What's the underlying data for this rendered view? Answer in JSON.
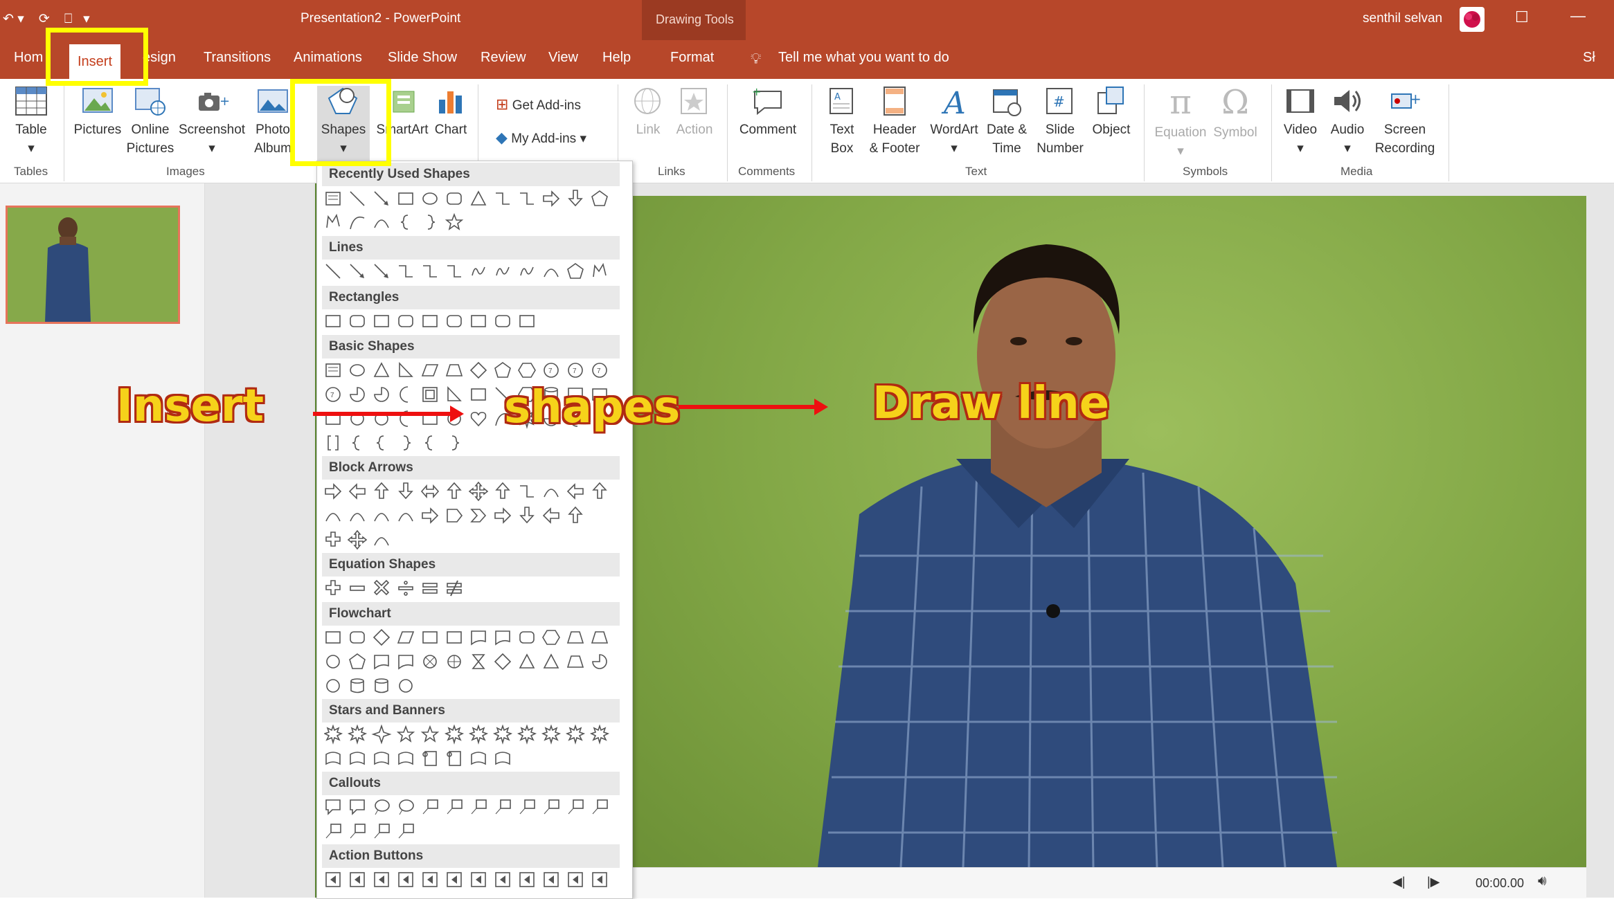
{
  "titlebar": {
    "doc_title": "Presentation2  -  PowerPoint",
    "context_tab_group": "Drawing Tools",
    "user_name": "senthil selvan"
  },
  "tabs": [
    {
      "label": "Hom"
    },
    {
      "label": "Insert"
    },
    {
      "label": "esign"
    },
    {
      "label": "Transitions"
    },
    {
      "label": "Animations"
    },
    {
      "label": "Slide Show"
    },
    {
      "label": "Review"
    },
    {
      "label": "View"
    },
    {
      "label": "Help"
    },
    {
      "label": "Format"
    }
  ],
  "tell_me": "Tell me what you want to do",
  "share_partial": "Sł",
  "ribbon": {
    "table": "Table",
    "pictures": "Pictures",
    "online_pictures_1": "Online",
    "online_pictures_2": "Pictures",
    "screenshot": "Screenshot",
    "photo_album_1": "Photo",
    "photo_album_2": "Album",
    "shapes": "Shapes",
    "smartart": "SmartArt",
    "chart": "Chart",
    "get_addins": "Get Add-ins",
    "my_addins": "My Add-ins",
    "link": "Link",
    "action": "Action",
    "comment": "Comment",
    "text_box_1": "Text",
    "text_box_2": "Box",
    "header_footer_1": "Header",
    "header_footer_2": "& Footer",
    "wordart": "WordArt",
    "date_time_1": "Date &",
    "date_time_2": "Time",
    "slide_number_1": "Slide",
    "slide_number_2": "Number",
    "object": "Object",
    "equation": "Equation",
    "symbol": "Symbol",
    "video": "Video",
    "audio": "Audio",
    "screen_recording_1": "Screen",
    "screen_recording_2": "Recording"
  },
  "groups": {
    "tables": "Tables",
    "images": "Images",
    "links": "Links",
    "comments": "Comments",
    "text": "Text",
    "symbols": "Symbols",
    "media": "Media"
  },
  "gallery_sections": [
    "Recently Used Shapes",
    "Lines",
    "Rectangles",
    "Basic Shapes",
    "Block Arrows",
    "Equation Shapes",
    "Flowchart",
    "Stars and Banners",
    "Callouts",
    "Action Buttons"
  ],
  "annotations": {
    "insert": "Insert",
    "shapes": "shapes",
    "draw_line": "Draw line"
  },
  "media": {
    "time": "00:00.00"
  },
  "colors": {
    "accent": "#b7472a",
    "highlight": "#ffff00",
    "annotation_text": "#f6d21a",
    "arrow": "#ee1010"
  }
}
